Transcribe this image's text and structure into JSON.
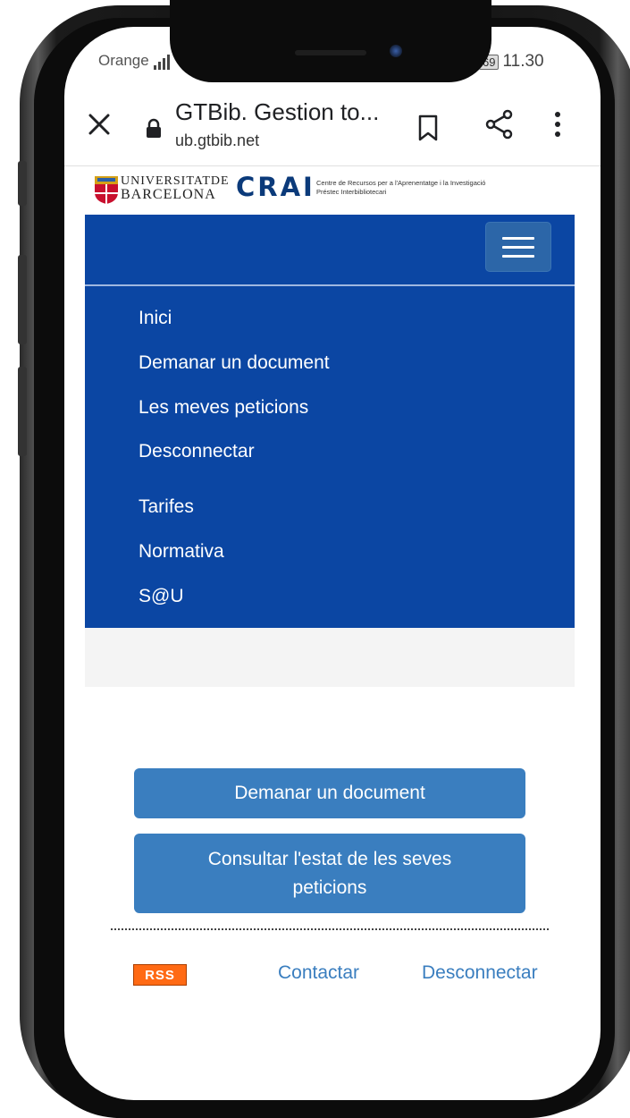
{
  "status_bar": {
    "carrier": "Orange",
    "battery": "69",
    "time": "11.30"
  },
  "browser": {
    "tab_title": "GTBib. Gestion to...",
    "url": "ub.gtbib.net",
    "icons": [
      "close-icon",
      "lock-icon",
      "bookmark-icon",
      "share-icon",
      "more-vert-icon"
    ]
  },
  "header": {
    "ub_line1": "UNIVERSITATDE",
    "ub_line2": "BARCELONA",
    "crai": "CRAI",
    "crai_sub1": "Centre de Recursos per a l'Aprenentatge i la Investigació",
    "crai_sub2": "Préstec Interbibliotecari"
  },
  "nav": {
    "menu_icon": "hamburger-menu-icon",
    "items": [
      "Inici",
      "Demanar un document",
      "Les meves peticions",
      "Desconnectar",
      "Tarifes",
      "Normativa",
      "S@U"
    ]
  },
  "main": {
    "request_button": "Demanar un document",
    "status_button_line1": "Consultar l'estat de les seves",
    "status_button_line2": "peticions"
  },
  "footer": {
    "rss": "RSS",
    "contact": "Contactar",
    "logout": "Desconnectar"
  },
  "colors": {
    "nav_bg": "#0b46a3",
    "button_bg": "#3a7ebf",
    "link": "#3a7ebf",
    "rss": "#ff6a14"
  }
}
